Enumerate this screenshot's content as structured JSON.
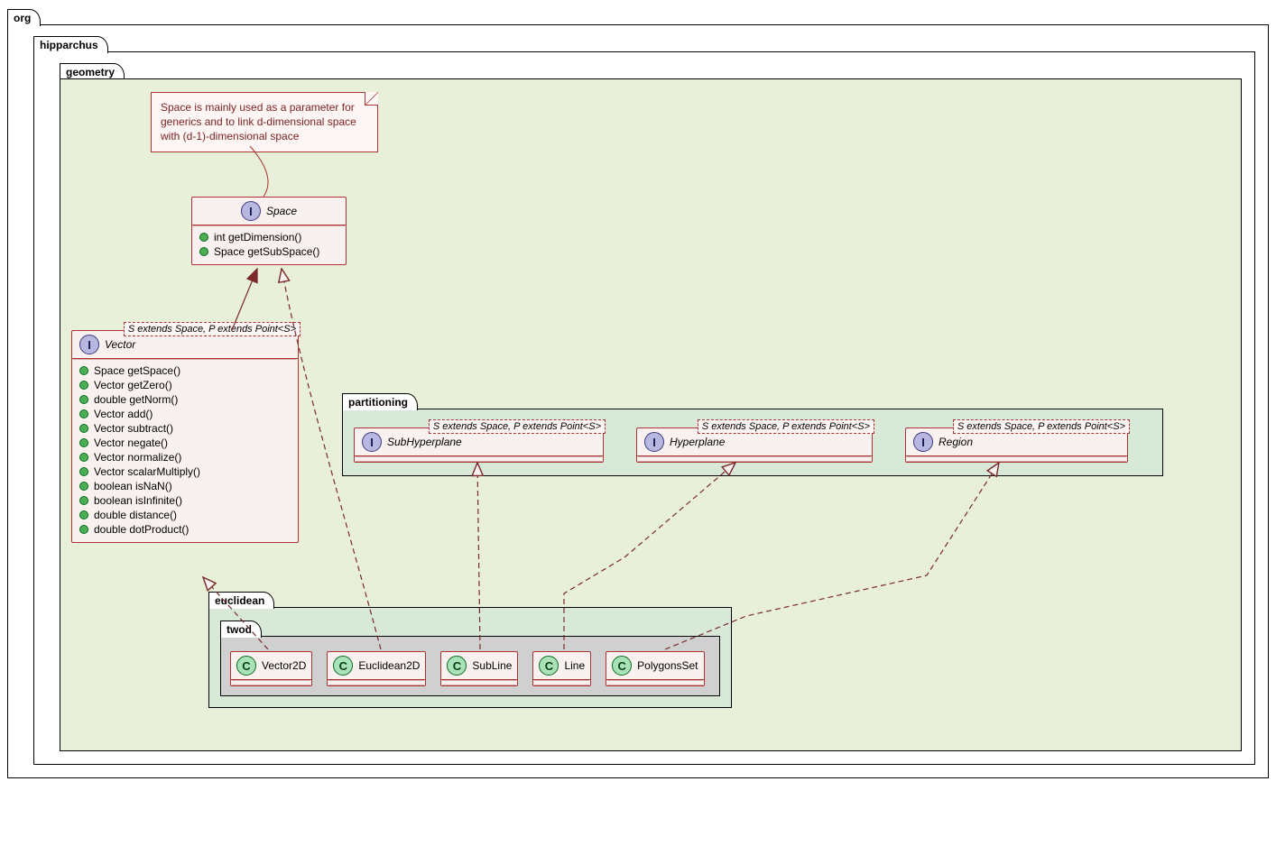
{
  "packages": {
    "org": "org",
    "hipparchus": "hipparchus",
    "geometry": "geometry",
    "partitioning": "partitioning",
    "euclidean": "euclidean",
    "twod": "twod"
  },
  "note": "Space is mainly used as a parameter for generics and to link d-dimensional space with (d-1)-dimensional space",
  "template_param": "S extends Space, P extends Point<S>",
  "classes": {
    "Space": {
      "name": "Space",
      "methods": [
        "int getDimension()",
        "Space getSubSpace()"
      ]
    },
    "Vector": {
      "name": "Vector",
      "methods": [
        "Space getSpace()",
        "Vector getZero()",
        "double getNorm()",
        "Vector add()",
        "Vector subtract()",
        "Vector negate()",
        "Vector normalize()",
        "Vector scalarMultiply()",
        "boolean isNaN()",
        "boolean isInfinite()",
        "double distance()",
        "double dotProduct()"
      ]
    },
    "SubHyperplane": {
      "name": "SubHyperplane"
    },
    "Hyperplane": {
      "name": "Hyperplane"
    },
    "Region": {
      "name": "Region"
    },
    "Vector2D": {
      "name": "Vector2D"
    },
    "Euclidean2D": {
      "name": "Euclidean2D"
    },
    "SubLine": {
      "name": "SubLine"
    },
    "Line": {
      "name": "Line"
    },
    "PolygonsSet": {
      "name": "PolygonsSet"
    }
  }
}
